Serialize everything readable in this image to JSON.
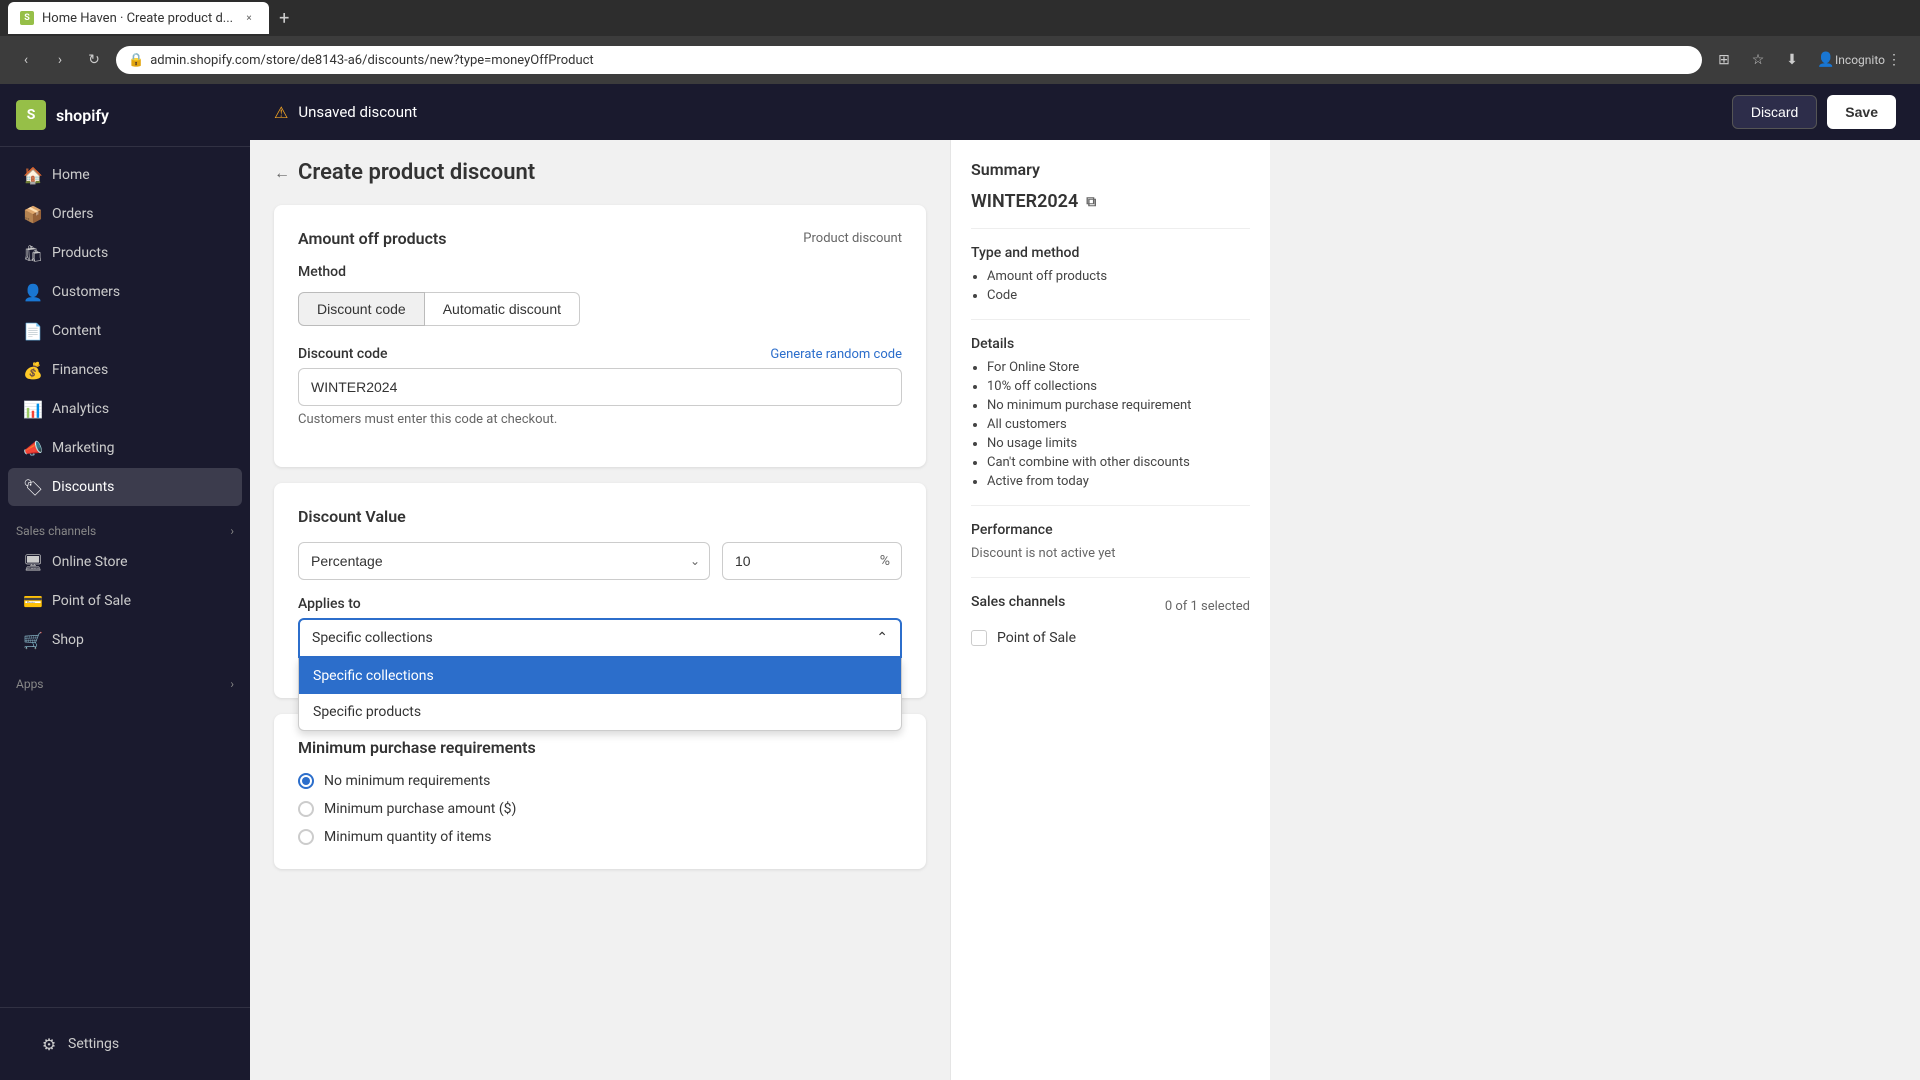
{
  "browser": {
    "tab_title": "Home Haven · Create product d...",
    "url": "admin.shopify.com/store/de8143-a6/discounts/new?type=moneyOffProduct",
    "new_tab_label": "+",
    "incognito_label": "Incognito"
  },
  "topbar": {
    "warning_text": "Unsaved discount",
    "discard_label": "Discard",
    "save_label": "Save"
  },
  "sidebar": {
    "logo_text": "shopify",
    "nav_items": [
      {
        "id": "home",
        "label": "Home",
        "icon": "🏠"
      },
      {
        "id": "orders",
        "label": "Orders",
        "icon": "📦"
      },
      {
        "id": "products",
        "label": "Products",
        "icon": "🛍"
      },
      {
        "id": "customers",
        "label": "Customers",
        "icon": "👤"
      },
      {
        "id": "content",
        "label": "Content",
        "icon": "📄"
      },
      {
        "id": "finances",
        "label": "Finances",
        "icon": "💰"
      },
      {
        "id": "analytics",
        "label": "Analytics",
        "icon": "📊"
      },
      {
        "id": "marketing",
        "label": "Marketing",
        "icon": "📣"
      },
      {
        "id": "discounts",
        "label": "Discounts",
        "icon": "🏷"
      }
    ],
    "sales_channels_label": "Sales channels",
    "sales_channels_arrow": "›",
    "channel_items": [
      {
        "id": "online-store",
        "label": "Online Store",
        "icon": "🖥"
      },
      {
        "id": "point-of-sale",
        "label": "Point of Sale",
        "icon": "💳"
      },
      {
        "id": "shop",
        "label": "Shop",
        "icon": "🛒"
      }
    ],
    "apps_label": "Apps",
    "apps_arrow": "›",
    "settings_label": "Settings",
    "settings_icon": "⚙"
  },
  "page": {
    "title": "Create product discount",
    "back_arrow": "←"
  },
  "card_main": {
    "title": "Amount off products",
    "badge": "Product discount",
    "method_section_label": "Method",
    "method_tabs": [
      {
        "id": "discount-code",
        "label": "Discount code",
        "active": true
      },
      {
        "id": "automatic",
        "label": "Automatic discount",
        "active": false
      }
    ],
    "discount_code_label": "Discount code",
    "discount_code_link": "Generate random code",
    "discount_code_value": "WINTER2024",
    "discount_code_hint": "Customers must enter this code at checkout."
  },
  "card_value": {
    "title": "Discount Value",
    "percentage_label": "Percentage",
    "value_input": "10",
    "value_suffix": "%",
    "applies_to_label": "Applies to",
    "applies_to_selected": "Specific collections",
    "dropdown_options": [
      {
        "id": "specific-collections",
        "label": "Specific collections",
        "selected": true
      },
      {
        "id": "specific-products",
        "label": "Specific products",
        "selected": false
      }
    ],
    "dropdown_arrow": "⌃"
  },
  "card_minimum": {
    "title": "Minimum purchase requirements",
    "options": [
      {
        "id": "no-minimum",
        "label": "No minimum requirements",
        "checked": true
      },
      {
        "id": "min-purchase",
        "label": "Minimum purchase amount ($)",
        "checked": false
      },
      {
        "id": "min-quantity",
        "label": "Minimum quantity of items",
        "checked": false
      }
    ]
  },
  "summary": {
    "title": "Summary",
    "code": "WINTER2024",
    "copy_icon": "⧉",
    "type_method_title": "Type and method",
    "type_method_items": [
      "Amount off products",
      "Code"
    ],
    "details_title": "Details",
    "details_items": [
      "For Online Store",
      "10% off collections",
      "No minimum purchase requirement",
      "All customers",
      "No usage limits",
      "Can't combine with other discounts",
      "Active from today"
    ],
    "performance_title": "Performance",
    "performance_text": "Discount is not active yet",
    "sales_channels_title": "Sales channels",
    "sales_channels_count": "0 of 1 selected",
    "channel_items": [
      {
        "id": "point-of-sale",
        "label": "Point of Sale",
        "checked": false
      }
    ]
  }
}
